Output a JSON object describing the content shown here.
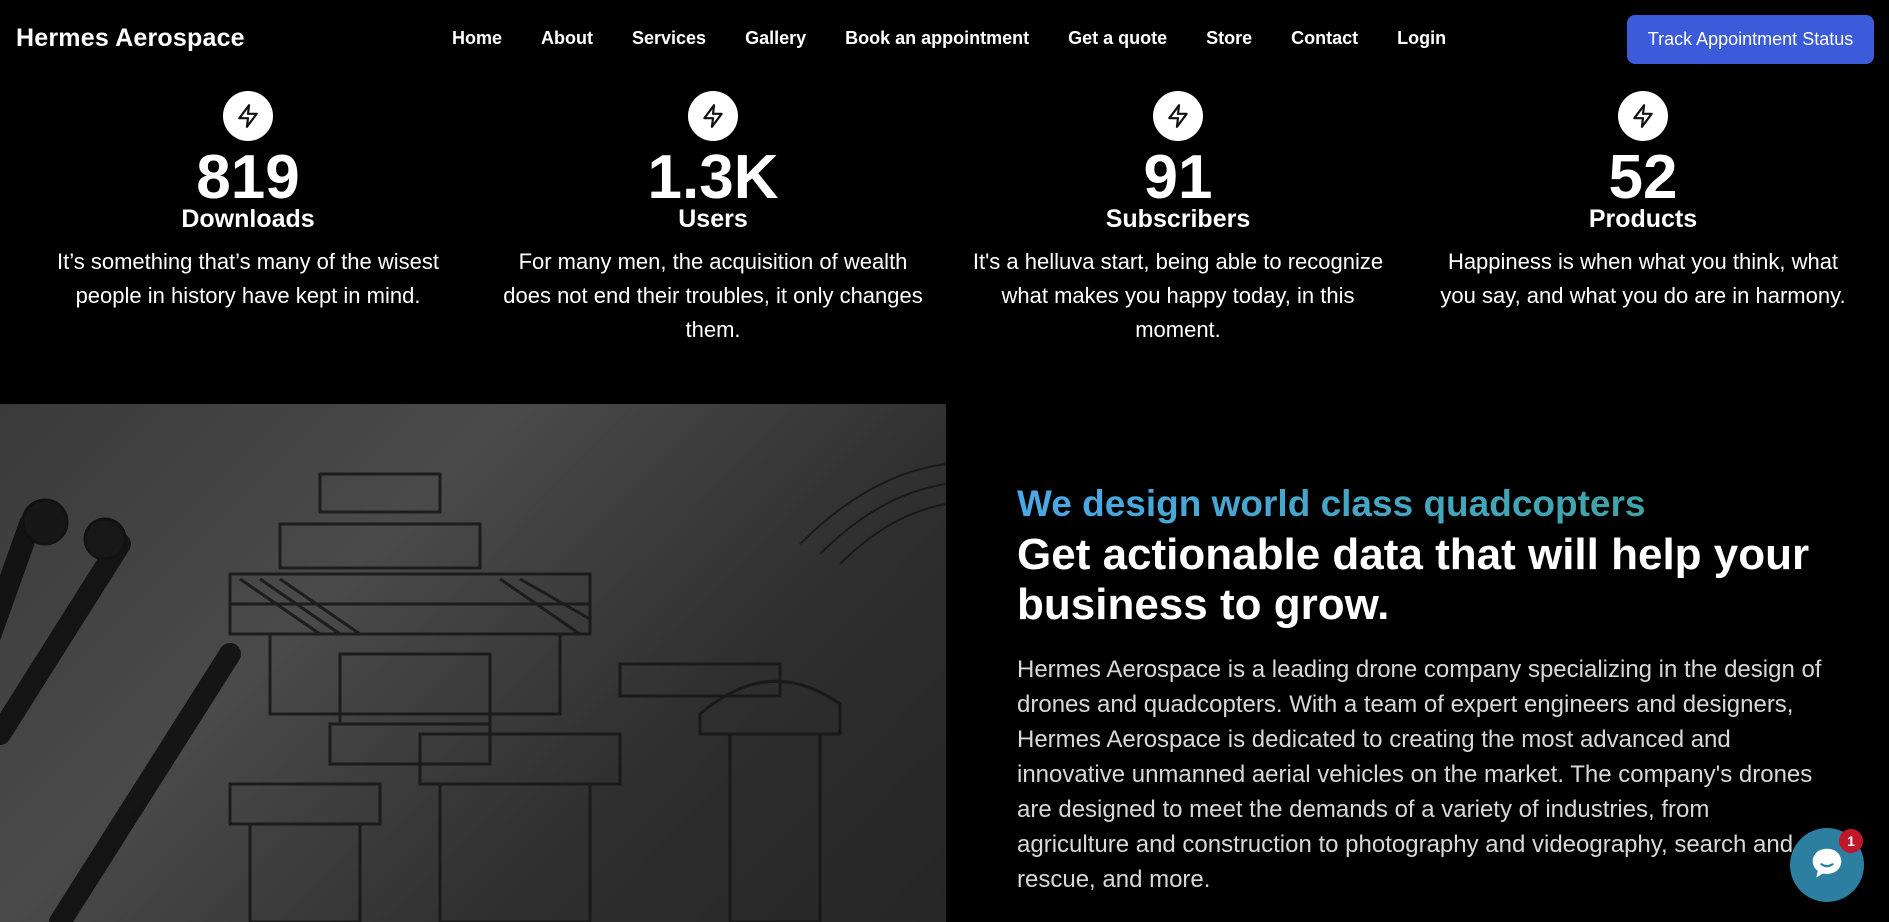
{
  "brand": "Hermes Aerospace",
  "nav": {
    "items": [
      {
        "label": "Home"
      },
      {
        "label": "About"
      },
      {
        "label": "Services"
      },
      {
        "label": "Gallery"
      },
      {
        "label": "Book an appointment"
      },
      {
        "label": "Get a quote"
      },
      {
        "label": "Store"
      },
      {
        "label": "Contact"
      },
      {
        "label": "Login"
      }
    ],
    "cta_label": "Track Appointment Status"
  },
  "stats": [
    {
      "icon": "lightning-icon",
      "value": "819",
      "label": "Downloads",
      "desc": "It’s something that’s many of the wisest people in history have kept in mind."
    },
    {
      "icon": "lightning-icon",
      "value": "1.3K",
      "label": "Users",
      "desc": "For many men, the acquisition of wealth does not end their troubles, it only changes them."
    },
    {
      "icon": "lightning-icon",
      "value": "91",
      "label": "Subscribers",
      "desc": "It's a helluva start, being able to recognize what makes you happy today, in this moment."
    },
    {
      "icon": "lightning-icon",
      "value": "52",
      "label": "Products",
      "desc": "Happiness is when what you think, what you say, and what you do are in harmony."
    }
  ],
  "about": {
    "kicker": "We design world class quadcopters",
    "headline": "Get actionable data that will help your business to grow.",
    "body": "Hermes Aerospace is a leading drone company specializing in the design of drones and quadcopters. With a team of expert engineers and designers, Hermes Aerospace is dedicated to creating the most advanced and innovative unmanned aerial vehicles on the market. The company's drones are designed to meet the demands of a variety of industries, from agriculture and construction to photography and videography, search and rescue, and more."
  },
  "chat": {
    "icon": "chat-icon",
    "badge": "1"
  },
  "colors": {
    "cta": "#3b5bdb",
    "kicker_start": "#4aa8e8",
    "kicker_end": "#3ca393",
    "chat": "#2c7fa0",
    "badge": "#c0182a"
  }
}
